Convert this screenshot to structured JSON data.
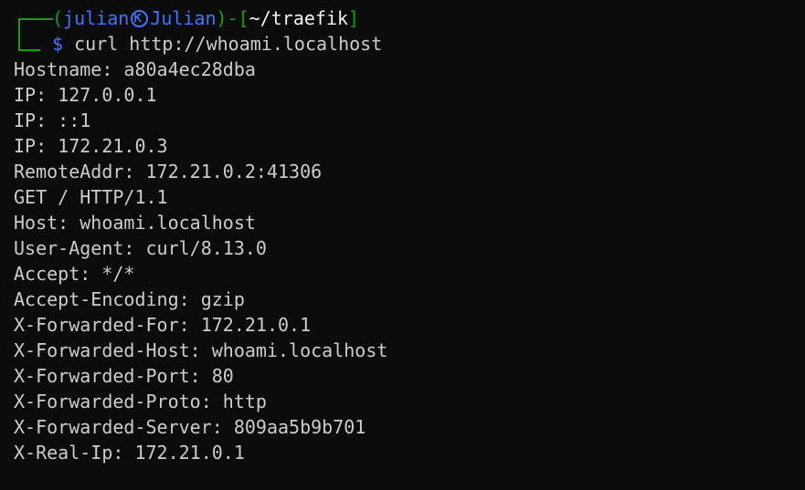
{
  "prompt": {
    "user": "julian",
    "host": "Julian",
    "dir": "~/traefik",
    "symbol": "$",
    "command": "curl http://whoami.localhost"
  },
  "output": [
    "Hostname: a80a4ec28dba",
    "IP: 127.0.0.1",
    "IP: ::1",
    "IP: 172.21.0.3",
    "RemoteAddr: 172.21.0.2:41306",
    "GET / HTTP/1.1",
    "Host: whoami.localhost",
    "User-Agent: curl/8.13.0",
    "Accept: */*",
    "Accept-Encoding: gzip",
    "X-Forwarded-For: 172.21.0.1",
    "X-Forwarded-Host: whoami.localhost",
    "X-Forwarded-Port: 80",
    "X-Forwarded-Proto: http",
    "X-Forwarded-Server: 809aa5b9b701",
    "X-Real-Ip: 172.21.0.1"
  ],
  "colors": {
    "background": "#0c0c0c",
    "text": "#cccccc",
    "prompt_green": "#13a10e",
    "prompt_blue": "#3b78ff"
  }
}
